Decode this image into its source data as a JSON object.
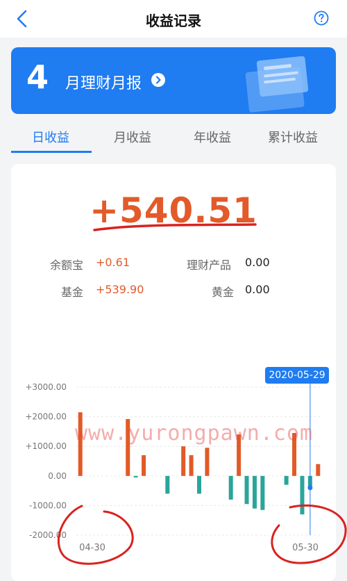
{
  "header": {
    "title": "收益记录",
    "back_icon": "back-arrow-icon",
    "help_icon": "question-mark-icon"
  },
  "banner": {
    "number": "4",
    "text": "月理财月报",
    "go_icon": "chevron-right-circle-icon",
    "color": "#1f7cf1"
  },
  "tabs": [
    {
      "label": "日收益",
      "active": true
    },
    {
      "label": "月收益",
      "active": false
    },
    {
      "label": "年收益",
      "active": false
    },
    {
      "label": "累计收益",
      "active": false
    }
  ],
  "summary": {
    "total": "+540.51",
    "items": [
      {
        "label": "余额宝",
        "value": "+0.61"
      },
      {
        "label": "理财产品",
        "value": "0.00"
      },
      {
        "label": "基金",
        "value": "+539.90"
      },
      {
        "label": "黄金",
        "value": "0.00"
      }
    ]
  },
  "watermark": "www.yurongpawn.com",
  "chart_data": {
    "type": "bar",
    "ylim": [
      -2000,
      3000
    ],
    "yticks": [
      "+3000.00",
      "+2000.00",
      "+1000.00",
      "0.00",
      "-1000.00",
      "-2000.00"
    ],
    "x_start_label": "04-30",
    "x_end_label": "05-30",
    "selected_label": "2020-05-29",
    "positive_color": "#e25a26",
    "negative_color": "#2aa59a",
    "values": [
      2150,
      0,
      0,
      0,
      0,
      0,
      1920,
      -50,
      700,
      0,
      0,
      -600,
      0,
      1000,
      700,
      -600,
      950,
      0,
      0,
      -800,
      1400,
      -950,
      -1100,
      -1150,
      0,
      0,
      -300,
      1450,
      -1300,
      -400,
      400
    ]
  }
}
